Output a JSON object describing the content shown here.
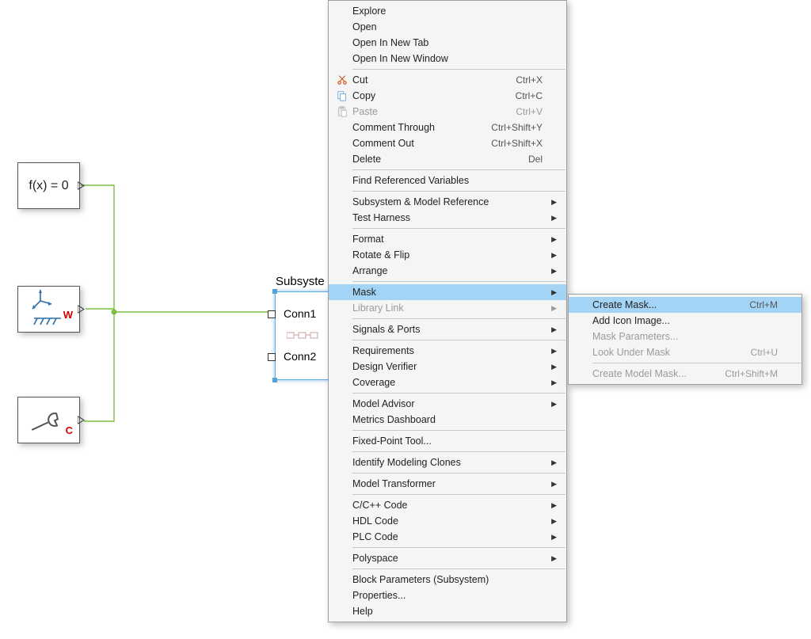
{
  "canvas": {
    "fx_block": {
      "label": "f(x) = 0"
    },
    "frame_block": {
      "port_letter": "W"
    },
    "config_block": {
      "port_letter": "C"
    },
    "subsystem": {
      "title": "Subsyste",
      "conn1": "Conn1",
      "conn2": "Conn2"
    }
  },
  "menu": {
    "items": [
      {
        "type": "item",
        "label": "Explore"
      },
      {
        "type": "item",
        "label": "Open"
      },
      {
        "type": "item",
        "label": "Open In New Tab"
      },
      {
        "type": "item",
        "label": "Open In New Window"
      },
      {
        "type": "sep"
      },
      {
        "type": "item",
        "label": "Cut",
        "accel": "Ctrl+X",
        "icon": "cut"
      },
      {
        "type": "item",
        "label": "Copy",
        "accel": "Ctrl+C",
        "icon": "copy"
      },
      {
        "type": "item",
        "label": "Paste",
        "accel": "Ctrl+V",
        "icon": "paste",
        "disabled": true
      },
      {
        "type": "item",
        "label": "Comment Through",
        "accel": "Ctrl+Shift+Y"
      },
      {
        "type": "item",
        "label": "Comment Out",
        "accel": "Ctrl+Shift+X"
      },
      {
        "type": "item",
        "label": "Delete",
        "accel": "Del"
      },
      {
        "type": "sep"
      },
      {
        "type": "item",
        "label": "Find Referenced Variables"
      },
      {
        "type": "sep"
      },
      {
        "type": "item",
        "label": "Subsystem & Model Reference",
        "submenu": true
      },
      {
        "type": "item",
        "label": "Test Harness",
        "submenu": true
      },
      {
        "type": "sep"
      },
      {
        "type": "item",
        "label": "Format",
        "submenu": true
      },
      {
        "type": "item",
        "label": "Rotate & Flip",
        "submenu": true
      },
      {
        "type": "item",
        "label": "Arrange",
        "submenu": true
      },
      {
        "type": "sep"
      },
      {
        "type": "item",
        "label": "Mask",
        "submenu": true,
        "highlight": true
      },
      {
        "type": "item",
        "label": "Library Link",
        "submenu": true,
        "disabled": true
      },
      {
        "type": "sep"
      },
      {
        "type": "item",
        "label": "Signals & Ports",
        "submenu": true
      },
      {
        "type": "sep"
      },
      {
        "type": "item",
        "label": "Requirements",
        "submenu": true
      },
      {
        "type": "item",
        "label": "Design Verifier",
        "submenu": true
      },
      {
        "type": "item",
        "label": "Coverage",
        "submenu": true
      },
      {
        "type": "sep"
      },
      {
        "type": "item",
        "label": "Model Advisor",
        "submenu": true
      },
      {
        "type": "item",
        "label": "Metrics Dashboard"
      },
      {
        "type": "sep"
      },
      {
        "type": "item",
        "label": "Fixed-Point Tool..."
      },
      {
        "type": "sep"
      },
      {
        "type": "item",
        "label": "Identify Modeling Clones",
        "submenu": true
      },
      {
        "type": "sep"
      },
      {
        "type": "item",
        "label": "Model Transformer",
        "submenu": true
      },
      {
        "type": "sep"
      },
      {
        "type": "item",
        "label": "C/C++ Code",
        "submenu": true
      },
      {
        "type": "item",
        "label": "HDL Code",
        "submenu": true
      },
      {
        "type": "item",
        "label": "PLC Code",
        "submenu": true
      },
      {
        "type": "sep"
      },
      {
        "type": "item",
        "label": "Polyspace",
        "submenu": true
      },
      {
        "type": "sep"
      },
      {
        "type": "item",
        "label": "Block Parameters (Subsystem)"
      },
      {
        "type": "item",
        "label": "Properties..."
      },
      {
        "type": "item",
        "label": "Help"
      }
    ]
  },
  "submenu": {
    "items": [
      {
        "label": "Create Mask...",
        "accel": "Ctrl+M",
        "highlight": true
      },
      {
        "label": "Add Icon Image..."
      },
      {
        "label": "Mask Parameters...",
        "disabled": true
      },
      {
        "label": "Look Under Mask",
        "accel": "Ctrl+U",
        "disabled": true
      },
      {
        "type": "sep"
      },
      {
        "label": "Create Model Mask...",
        "accel": "Ctrl+Shift+M",
        "disabled": true
      }
    ]
  }
}
